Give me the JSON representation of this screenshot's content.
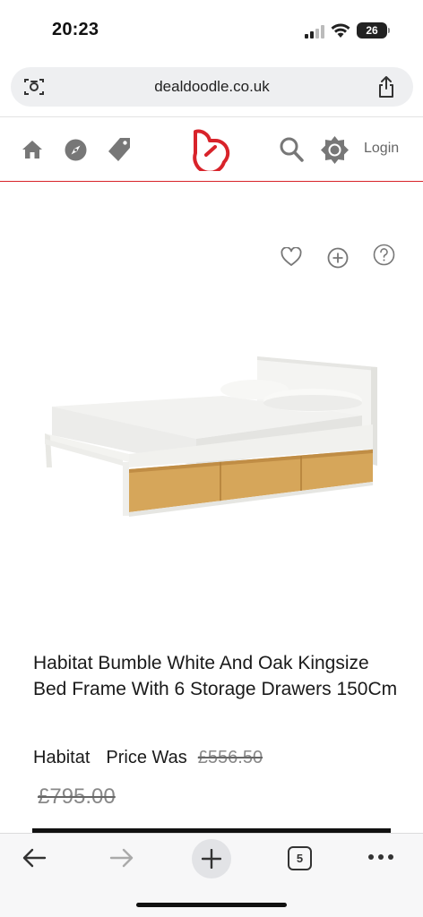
{
  "status_bar": {
    "time": "20:23",
    "battery_level": "26"
  },
  "browser": {
    "url": "dealdoodle.co.uk",
    "tab_count": "5",
    "icons": [
      "camera-search-icon",
      "share-icon",
      "back-arrow-icon",
      "forward-arrow-icon",
      "new-tab-plus-icon",
      "tabs-icon",
      "more-icon"
    ]
  },
  "site_header": {
    "icons": [
      "home-icon",
      "compass-icon",
      "tag-icon",
      "dealdoodle-logo",
      "search-icon",
      "brightness-icon"
    ],
    "login_label": "Login",
    "accent_color": "#d8232a"
  },
  "product": {
    "action_icons": [
      "heart-icon",
      "add-circle-icon",
      "help-circle-icon"
    ],
    "title": "Habitat Bumble White And Oak Kingsize Bed Frame With 6 Storage Drawers 150Cm",
    "brand": "Habitat",
    "price_was_label": "Price Was",
    "price_was": "£556.50",
    "old_price": "£795.00"
  }
}
